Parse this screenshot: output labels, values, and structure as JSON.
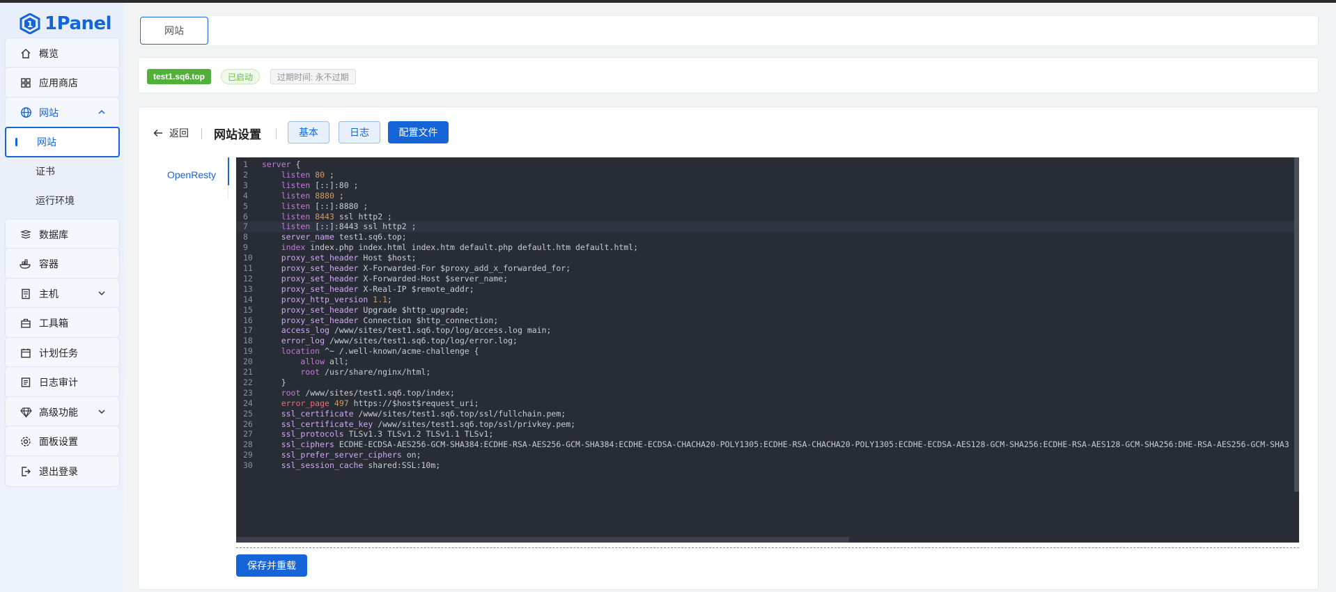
{
  "app": {
    "name": "1Panel"
  },
  "sidebar": {
    "items": [
      {
        "id": "overview",
        "label": "概览",
        "icon": "home-icon"
      },
      {
        "id": "appstore",
        "label": "应用商店",
        "icon": "grid-icon"
      },
      {
        "id": "website",
        "label": "网站",
        "icon": "globe-icon",
        "expanded": true
      },
      {
        "id": "database",
        "label": "数据库",
        "icon": "database-icon"
      },
      {
        "id": "container",
        "label": "容器",
        "icon": "container-icon"
      },
      {
        "id": "host",
        "label": "主机",
        "icon": "server-icon"
      },
      {
        "id": "toolbox",
        "label": "工具箱",
        "icon": "toolbox-icon"
      },
      {
        "id": "cron",
        "label": "计划任务",
        "icon": "calendar-icon"
      },
      {
        "id": "audit",
        "label": "日志审计",
        "icon": "log-icon"
      },
      {
        "id": "advanced",
        "label": "高级功能",
        "icon": "diamond-icon"
      },
      {
        "id": "settings",
        "label": "面板设置",
        "icon": "gear-icon"
      },
      {
        "id": "logout",
        "label": "退出登录",
        "icon": "logout-icon"
      }
    ],
    "website_sub": [
      {
        "label": "网站",
        "active": true
      },
      {
        "label": "证书",
        "active": false
      },
      {
        "label": "运行环境",
        "active": false
      }
    ]
  },
  "tabs": {
    "site_tab": "网站"
  },
  "status": {
    "domain": "test1.sq6.top",
    "state": "已启动",
    "expire": "过期时间: 永不过期"
  },
  "main": {
    "back": "返回",
    "title": "网站设置",
    "btn_basic": "基本",
    "btn_log": "日志",
    "btn_config": "配置文件",
    "side_tab": "OpenResty",
    "save": "保存并重载"
  },
  "editor": {
    "active_line": 7,
    "lines": [
      "server {",
      "    listen 80 ;",
      "    listen [::]:80 ;",
      "    listen 8880 ;",
      "    listen [::]:8880 ;",
      "    listen 8443 ssl http2 ;",
      "    listen [::]:8443 ssl http2 ;",
      "    server_name test1.sq6.top;",
      "    index index.php index.html index.htm default.php default.htm default.html;",
      "    proxy_set_header Host $host;",
      "    proxy_set_header X-Forwarded-For $proxy_add_x_forwarded_for;",
      "    proxy_set_header X-Forwarded-Host $server_name;",
      "    proxy_set_header X-Real-IP $remote_addr;",
      "    proxy_http_version 1.1;",
      "    proxy_set_header Upgrade $http_upgrade;",
      "    proxy_set_header Connection $http_connection;",
      "    access_log /www/sites/test1.sq6.top/log/access.log main;",
      "    error_log /www/sites/test1.sq6.top/log/error.log;",
      "    location ^~ /.well-known/acme-challenge {",
      "        allow all;",
      "        root /usr/share/nginx/html;",
      "    }",
      "    root /www/sites/test1.sq6.top/index;",
      "    error_page 497 https://$host$request_uri;",
      "    ssl_certificate /www/sites/test1.sq6.top/ssl/fullchain.pem;",
      "    ssl_certificate_key /www/sites/test1.sq6.top/ssl/privkey.pem;",
      "    ssl_protocols TLSv1.3 TLSv1.2 TLSv1.1 TLSv1;",
      "    ssl_ciphers ECDHE-ECDSA-AES256-GCM-SHA384:ECDHE-RSA-AES256-GCM-SHA384:ECDHE-ECDSA-CHACHA20-POLY1305:ECDHE-RSA-CHACHA20-POLY1305:ECDHE-ECDSA-AES128-GCM-SHA256:ECDHE-RSA-AES128-GCM-SHA256:DHE-RSA-AES256-GCM-SHA3",
      "    ssl_prefer_server_ciphers on;",
      "    ssl_session_cache shared:SSL:10m;"
    ]
  },
  "colors": {
    "primary": "#1565d8",
    "success": "#52b03a",
    "editor_bg": "#282c34"
  }
}
